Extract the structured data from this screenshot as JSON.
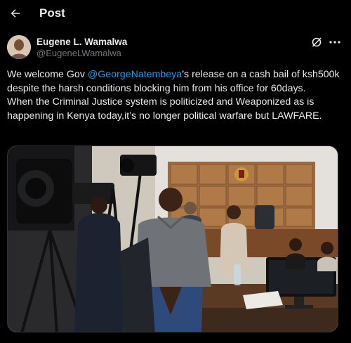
{
  "header": {
    "back_icon": "arrow-left-icon",
    "title": "Post"
  },
  "author": {
    "display_name": "Eugene L. Wamalwa",
    "handle": "@EugeneLWamalwa",
    "grok_icon": "grok-slash-icon",
    "more_icon": "more-horizontal-icon"
  },
  "tweet": {
    "part1": "We welcome Gov ",
    "mention": "@GeorgeNatembeya",
    "part2": "’s release on a cash bail of ksh500k despite the harsh conditions blocking him from his office for 60days.",
    "part3": "When the Criminal Justice system is politicized and Weaponized as is happening in Kenya today,it’s no longer political warfare but LAWFARE."
  },
  "colors": {
    "background": "#000000",
    "text": "#e7e9ea",
    "secondary": "#71767b",
    "link": "#1d9bf0"
  }
}
